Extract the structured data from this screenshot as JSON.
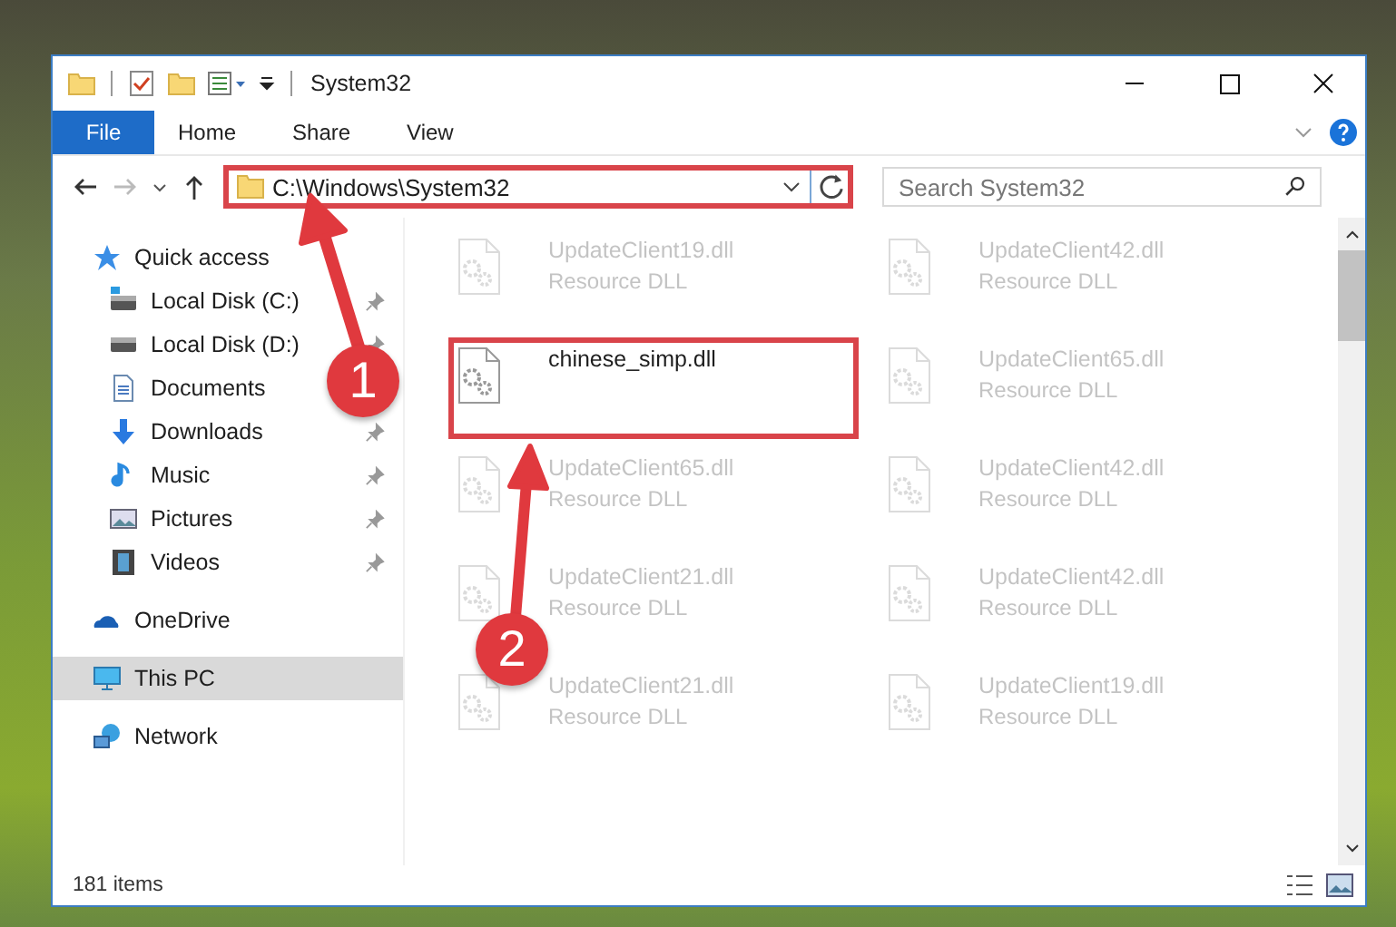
{
  "window": {
    "title": "System32"
  },
  "ribbon": {
    "tabs": [
      {
        "label": "File",
        "selected": true
      },
      {
        "label": "Home",
        "selected": false
      },
      {
        "label": "Share",
        "selected": false
      },
      {
        "label": "View",
        "selected": false
      }
    ]
  },
  "address": {
    "path": "C:\\Windows\\System32",
    "highlighted": true
  },
  "search": {
    "placeholder": "Search System32"
  },
  "sidebar": {
    "items": [
      {
        "label": "Quick access",
        "selected": false,
        "children": [
          {
            "label": "Local Disk (C:)",
            "selected": false,
            "pinned": true
          },
          {
            "label": "Local Disk (D:)",
            "selected": false,
            "pinned": true
          },
          {
            "label": "Documents",
            "selected": false,
            "pinned": false
          },
          {
            "label": "Downloads",
            "selected": false,
            "pinned": true
          },
          {
            "label": "Music",
            "selected": false,
            "pinned": true
          },
          {
            "label": "Pictures",
            "selected": false,
            "pinned": true
          },
          {
            "label": "Videos",
            "selected": false,
            "pinned": true
          }
        ]
      },
      {
        "label": "OneDrive",
        "selected": false
      },
      {
        "label": "This PC",
        "selected": true
      },
      {
        "label": "Network",
        "selected": false
      }
    ]
  },
  "files": [
    {
      "name": "UpdateClient19.dll",
      "type": "Resource DLL",
      "highlighted": false
    },
    {
      "name": "UpdateClient42.dll",
      "type": "Resource DLL",
      "highlighted": false
    },
    {
      "name": "chinese_simp.dll",
      "highlighted": true
    },
    {
      "name": "UpdateClient65.dll",
      "type": "Resource DLL",
      "highlighted": false
    },
    {
      "name": "UpdateClient65.dll",
      "type": "Resource DLL",
      "highlighted": false
    },
    {
      "name": "UpdateClient42.dll",
      "type": "Resource DLL",
      "highlighted": false
    },
    {
      "name": "UpdateClient21.dll",
      "type": "Resource DLL",
      "highlighted": false
    },
    {
      "name": "UpdateClient42.dll",
      "type": "Resource DLL",
      "highlighted": false
    },
    {
      "name": "UpdateClient21.dll",
      "type": "Resource DLL",
      "highlighted": false
    },
    {
      "name": "UpdateClient19.dll",
      "type": "Resource DLL",
      "highlighted": false
    }
  ],
  "status_bar": {
    "item_count": "181 items"
  },
  "annotations": [
    {
      "label": "1"
    },
    {
      "label": "2"
    }
  ]
}
